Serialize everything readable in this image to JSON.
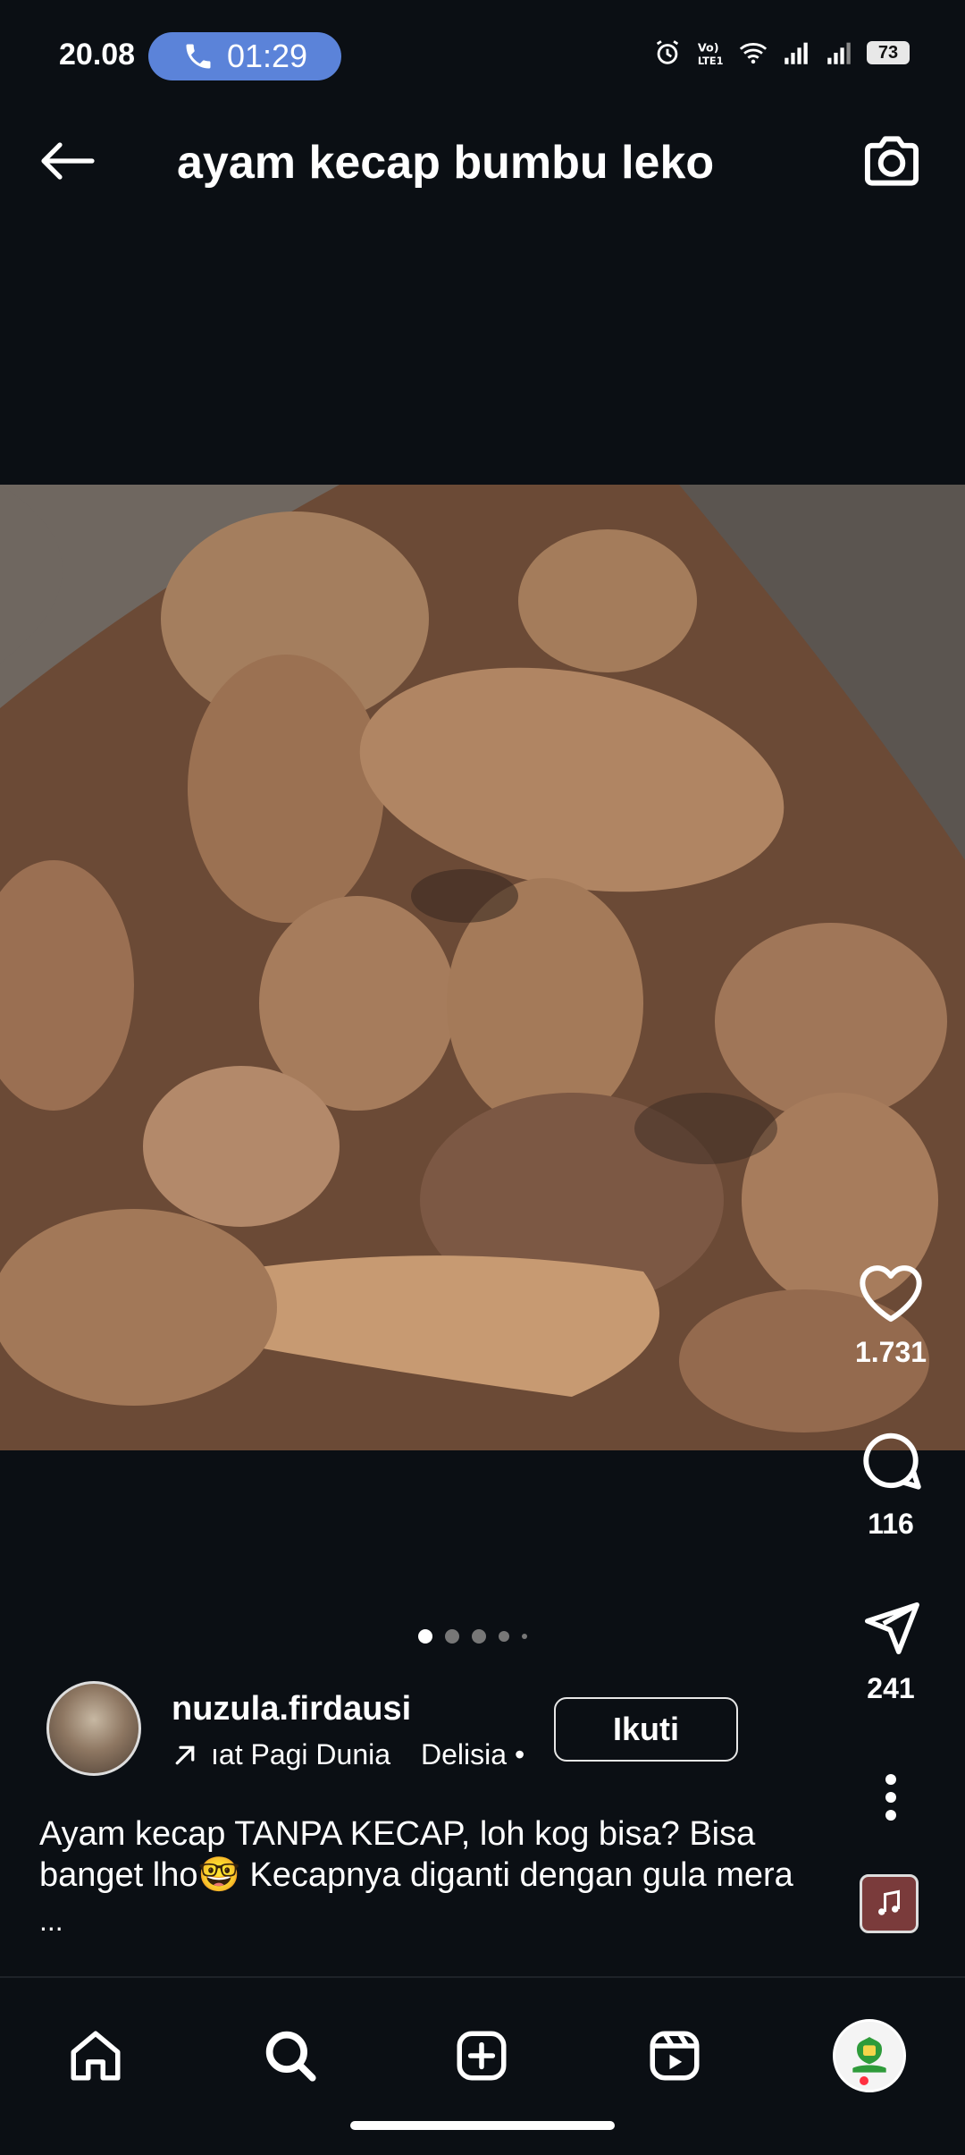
{
  "status_bar": {
    "time": "20.08",
    "call_duration": "01:29",
    "battery": "73"
  },
  "header": {
    "title": "ayam kecap bumbu leko"
  },
  "actions": {
    "likes": "1.731",
    "comments": "116",
    "shares": "241"
  },
  "author": {
    "username": "nuzula.firdausi",
    "music_left": "ıat Pagi Dunia",
    "music_right": "Delisia •",
    "follow_label": "Ikuti"
  },
  "caption": {
    "text": "Ayam kecap TANPA KECAP, loh kog bisa? Bisa banget lho🤓 Kecapnya diganti dengan gula mera",
    "more": "..."
  },
  "carousel": {
    "count": 5,
    "active_index": 0
  },
  "colors": {
    "background": "#0b0f14",
    "call_pill": "#5b83d9",
    "notification_dot": "#ff3040"
  },
  "icons": [
    "back-arrow-icon",
    "camera-icon",
    "heart-icon",
    "comment-icon",
    "send-icon",
    "more-icon",
    "home-icon",
    "search-icon",
    "create-icon",
    "reels-icon"
  ]
}
